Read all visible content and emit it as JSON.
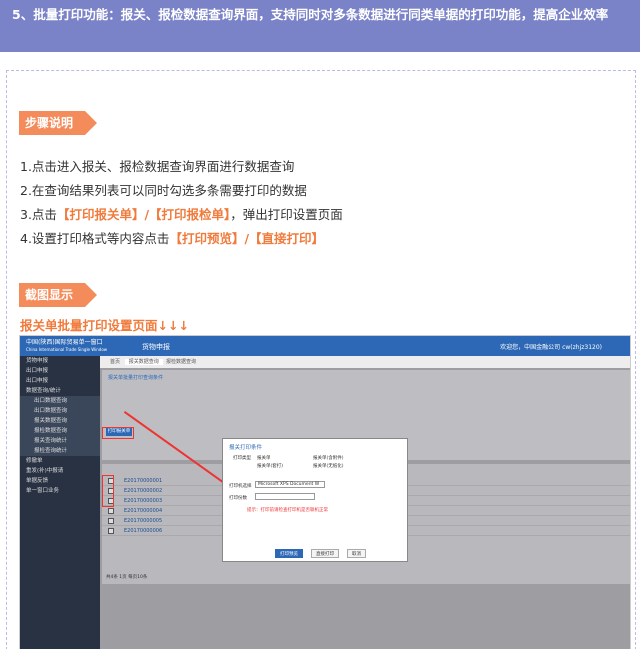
{
  "header": {
    "text": "5、批量打印功能：报关、报检数据查询界面，支持同时对多条数据进行同类单据的打印功能，提高企业效率"
  },
  "steps_tag": "步骤说明",
  "steps": [
    {
      "before": "1.点击进入报关、报检数据查询界面进行数据查询",
      "hl": "",
      "after": ""
    },
    {
      "before": "2.在查询结果列表可以同时勾选多条需要打印的数据",
      "hl": "",
      "after": ""
    },
    {
      "before": "3.点击",
      "hl": "【打印报关单】/【打印报检单】",
      "after": "，弹出打印设置页面"
    },
    {
      "before": "4.设置打印格式等内容点击",
      "hl": "【打印预览】/【直接打印】",
      "after": ""
    }
  ],
  "screenshot_tag": "截图显示",
  "subtitle": "报关单批量打印设置页面↓↓↓",
  "screenshot": {
    "app_logo_line1": "中国(陕西)国际贸易单一窗口",
    "app_logo_line2": "China International Trade Single Window",
    "system": "货物申报",
    "user": "欢迎您，中国金融公司 cw(zhjz3120)",
    "tabs": [
      "首页",
      "报关数据查询",
      "报检数据查询"
    ],
    "sidebar": [
      {
        "label": "货物申报",
        "sub": false
      },
      {
        "label": "出口申报",
        "sub": false
      },
      {
        "label": "出口申报",
        "sub": false
      },
      {
        "label": "数据查询/统计",
        "sub": false
      },
      {
        "label": "出口数据查询",
        "sub": true
      },
      {
        "label": "出口数据查询",
        "sub": true
      },
      {
        "label": "报关数据查询",
        "sub": true
      },
      {
        "label": "报检数据查询",
        "sub": true
      },
      {
        "label": "报关查询统计",
        "sub": true
      },
      {
        "label": "报检查询统计",
        "sub": true
      },
      {
        "label": "修撤单",
        "sub": false
      },
      {
        "label": "重发(补)中报请",
        "sub": false
      },
      {
        "label": "单据反馈",
        "sub": false
      },
      {
        "label": "单一窗口业务",
        "sub": false
      }
    ],
    "form_title": "报关单批量打印查询条件",
    "print_button": "打印报关单",
    "rows": [
      "E20170000001",
      "E20170000002",
      "E20170000003",
      "E20170000004",
      "E20170000005",
      "E20170000006"
    ],
    "footer": "共4条 1页 每页10条",
    "dialog": {
      "title": "报关打印条件",
      "print_type": "打印类型",
      "options": [
        "报关单",
        "报关单(含附件)",
        "报关单(套打)",
        "报关单(无纸化)"
      ],
      "printer_label": "打印机选择",
      "printer": "Microsoft XPS Document W",
      "copies_label": "打印份数",
      "note": "提示：打印前请检查打印机是否联机正常",
      "buttons": [
        "打印预览",
        "直接打印",
        "取消"
      ]
    }
  }
}
